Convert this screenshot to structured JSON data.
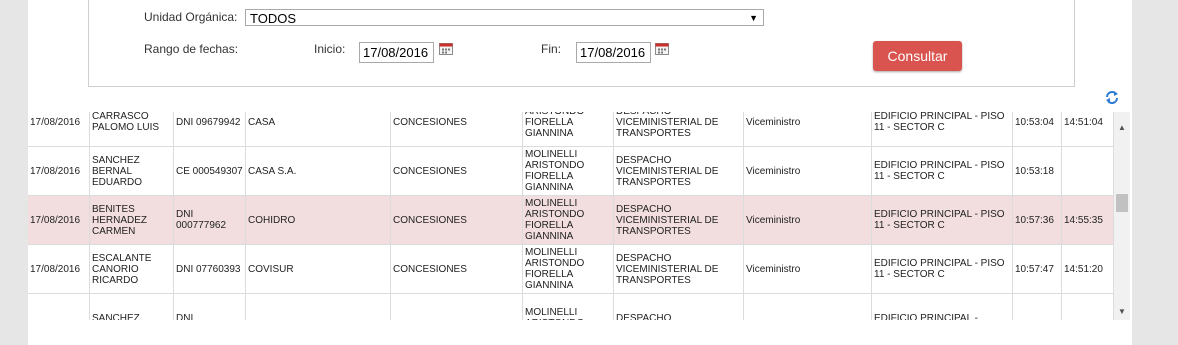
{
  "filters": {
    "unidad_label": "Unidad Orgánica:",
    "unidad_value": "TODOS",
    "rango_label": "Rango de fechas:",
    "inicio_label": "Inicio:",
    "inicio_value": "17/08/2016",
    "fin_label": "Fin:",
    "fin_value": "17/08/2016",
    "consultar_label": "Consultar"
  },
  "table": {
    "rows": [
      {
        "fecha": "17/08/2016",
        "visitante": "CARRASCO PALOMO LUIS",
        "documento": "DNI 09679942",
        "entidad": "CASA",
        "motivo": "CONCESIONES",
        "empleado": "ARISTONDO FIORELLA GIANNINA",
        "oficina": "DESPACHO VICEMINISTERIAL DE TRANSPORTES",
        "cargo": "Viceministro",
        "lugar": "EDIFICIO PRINCIPAL - PISO 11 - SECTOR C",
        "ingreso": "10:53:04",
        "salida": "14:51:04",
        "highlight": false
      },
      {
        "fecha": "17/08/2016",
        "visitante": "SANCHEZ BERNAL EDUARDO",
        "documento": "CE 000549307",
        "entidad": "CASA S.A.",
        "motivo": "CONCESIONES",
        "empleado": "MOLINELLI ARISTONDO FIORELLA GIANNINA",
        "oficina": "DESPACHO VICEMINISTERIAL DE TRANSPORTES",
        "cargo": "Viceministro",
        "lugar": "EDIFICIO PRINCIPAL - PISO 11 - SECTOR C",
        "ingreso": "10:53:18",
        "salida": "",
        "highlight": false
      },
      {
        "fecha": "17/08/2016",
        "visitante": "BENITES HERNADEZ CARMEN",
        "documento": "DNI 000777962",
        "entidad": "COHIDRO",
        "motivo": "CONCESIONES",
        "empleado": "MOLINELLI ARISTONDO FIORELLA GIANNINA",
        "oficina": "DESPACHO VICEMINISTERIAL DE TRANSPORTES",
        "cargo": "Viceministro",
        "lugar": "EDIFICIO PRINCIPAL - PISO 11 - SECTOR C",
        "ingreso": "10:57:36",
        "salida": "14:55:35",
        "highlight": true
      },
      {
        "fecha": "17/08/2016",
        "visitante": "ESCALANTE CANORIO RICARDO",
        "documento": "DNI 07760393",
        "entidad": "COVISUR",
        "motivo": "CONCESIONES",
        "empleado": "MOLINELLI ARISTONDO FIORELLA GIANNINA",
        "oficina": "DESPACHO VICEMINISTERIAL DE TRANSPORTES",
        "cargo": "Viceministro",
        "lugar": "EDIFICIO PRINCIPAL - PISO 11 - SECTOR C",
        "ingreso": "10:57:47",
        "salida": "14:51:20",
        "highlight": false
      },
      {
        "fecha": "",
        "visitante": "SANCHEZ",
        "documento": "DNI",
        "entidad": "",
        "motivo": "",
        "empleado": "MOLINELLI ARISTONDO",
        "oficina": "DESPACHO",
        "cargo": "",
        "lugar": "EDIFICIO PRINCIPAL -",
        "ingreso": "",
        "salida": "",
        "highlight": false
      }
    ]
  },
  "icons": {
    "calendar": "calendar-icon",
    "refresh": "refresh-icon",
    "dropdown": "chevron-down-icon"
  },
  "colors": {
    "button": "#d9534f",
    "highlight_row": "#f2dede"
  }
}
